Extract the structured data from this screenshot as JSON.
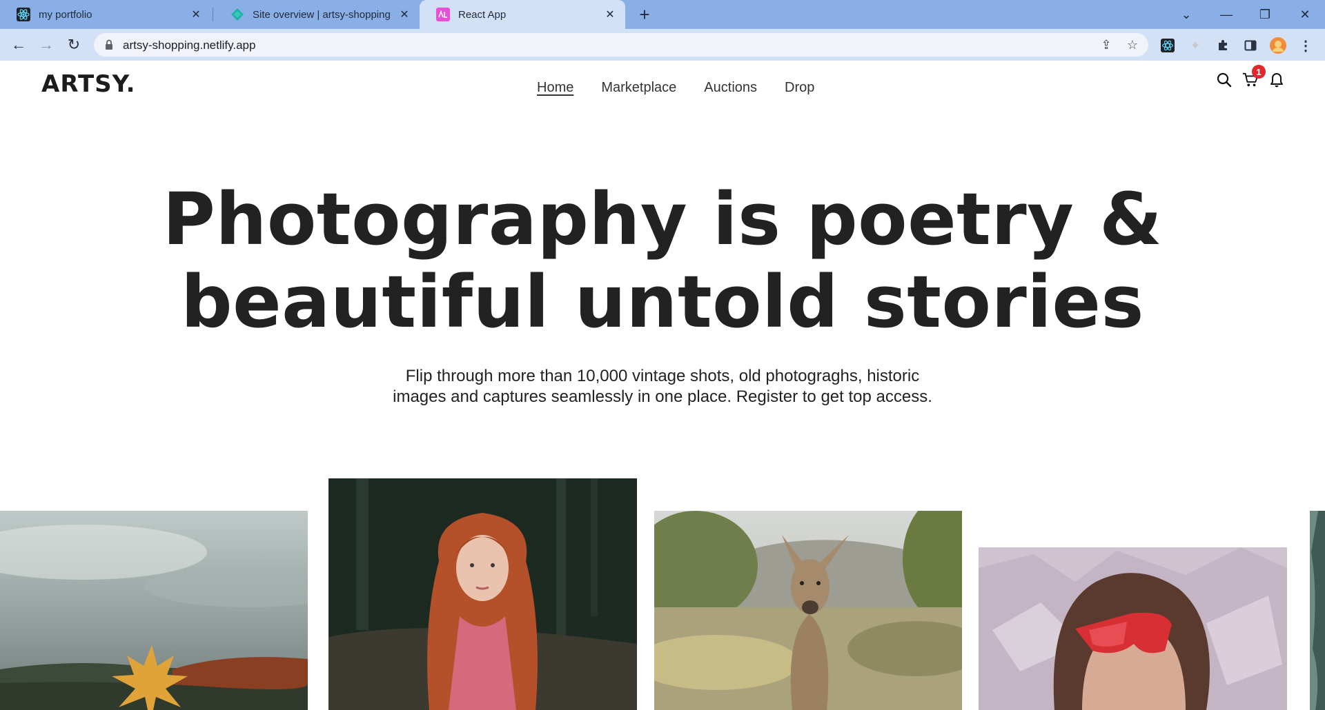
{
  "browser": {
    "tabs": [
      {
        "title": "my portfolio",
        "icon": "react-icon"
      },
      {
        "title": "Site overview | artsy-shopping",
        "icon": "netlify-icon"
      },
      {
        "title": "React App",
        "icon": "react-app-icon",
        "active": true
      }
    ],
    "url": "artsy-shopping.netlify.app"
  },
  "site": {
    "logo": "ARTSY.",
    "nav": [
      "Home",
      "Marketplace",
      "Auctions",
      "Drop"
    ],
    "active_nav": "Home",
    "cart_count": "1",
    "icons": [
      "search-icon",
      "cart-icon",
      "bell-icon"
    ],
    "accent_color": "#e0282e"
  },
  "hero": {
    "title_line1": "Photography is poetry &",
    "title_line2": "beautiful untold stories",
    "subtitle_line1": "Flip through more than 10,000 vintage shots, old photograghs, historic",
    "subtitle_line2": "images and captures seamlessly in one place. Register to get top access."
  },
  "gallery": [
    "maple-leaf-landscape-photo",
    "red-haired-woman-photo",
    "kangaroo-photo",
    "person-red-sunglasses-photo"
  ]
}
